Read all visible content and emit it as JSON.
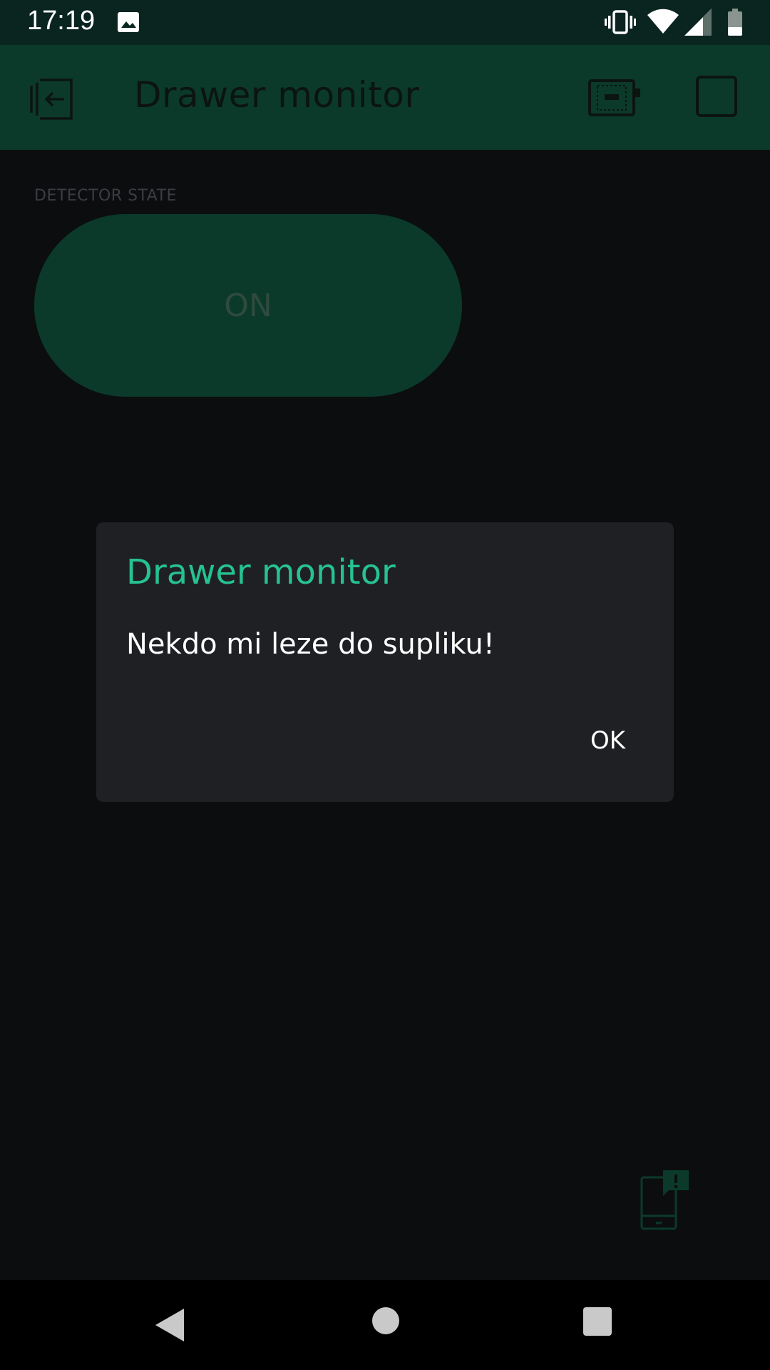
{
  "status_bar": {
    "time": "17:19",
    "icons": [
      "image-icon",
      "vibrate-icon",
      "wifi-icon",
      "cellular-signal-icon",
      "battery-icon"
    ]
  },
  "app_bar": {
    "title": "Drawer monitor",
    "icons": [
      "back-to-projects-icon",
      "device-icon",
      "stop-icon"
    ]
  },
  "widget": {
    "label": "DETECTOR STATE",
    "button_label": "ON"
  },
  "dialog": {
    "title": "Drawer monitor",
    "message": "Nekdo mi leze do supliku!",
    "ok_label": "OK"
  },
  "colors": {
    "accent": "#26c28f",
    "app_bar": "#0b3a2a",
    "dialog_bg": "#1f2024",
    "background": "#0c0d0f"
  }
}
